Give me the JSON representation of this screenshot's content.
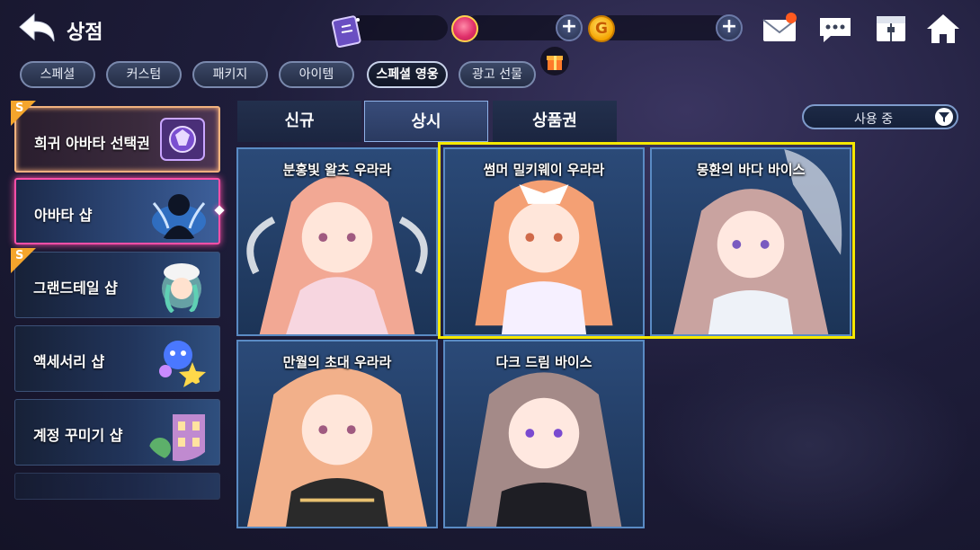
{
  "header": {
    "title": "상점"
  },
  "currency": {
    "gold_symbol": "G"
  },
  "category_tabs": [
    "스페셜",
    "커스텀",
    "패키지",
    "아이템",
    "스페셜 영웅",
    "광고 선물"
  ],
  "active_category": "스페셜 영웅",
  "sidebar": {
    "items": [
      {
        "label": "희귀 아바타 선택권"
      },
      {
        "label": "아바타 샵"
      },
      {
        "label": "그랜드테일 샵"
      },
      {
        "label": "액세서리 샵"
      },
      {
        "label": "계정 꾸미기 샵"
      }
    ],
    "badge": "S"
  },
  "sub_tabs": [
    "신규",
    "상시",
    "상품권"
  ],
  "active_sub_tab": "상시",
  "filter": {
    "label": "사용 중"
  },
  "cards": [
    {
      "name": "분홍빛 왈츠 우라라"
    },
    {
      "name": "썸머 밀키웨이 우라라"
    },
    {
      "name": "몽환의 바다 바이스"
    },
    {
      "name": "만월의 초대 우라라"
    },
    {
      "name": "다크 드림 바이스"
    }
  ],
  "colors": {
    "highlight": "#f5e800",
    "selected_border": "#ff4fa8",
    "rare_border": "#f2b37f"
  }
}
